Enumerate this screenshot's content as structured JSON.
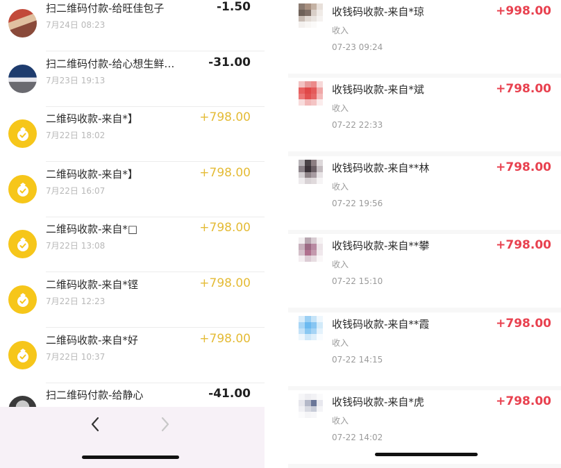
{
  "left_list": {
    "rows": [
      {
        "title": "扫二维码付款-给旺佳包子",
        "time": "7月24日 08:23",
        "amount": "-1.50",
        "kind": "payment",
        "avatar": "store-photo"
      },
      {
        "title": "扫二维码付款-给心想生鲜…",
        "time": "7月23日 19:13",
        "amount": "-31.00",
        "kind": "payment",
        "avatar": "store-photo"
      },
      {
        "title": "二维码收款-来自*】",
        "time": "7月22日 18:02",
        "amount": "+798.00",
        "kind": "receipt",
        "avatar": "money-bag"
      },
      {
        "title": "二维码收款-来自*】",
        "time": "7月22日 16:07",
        "amount": "+798.00",
        "kind": "receipt",
        "avatar": "money-bag"
      },
      {
        "title": "二维码收款-来自*□",
        "time": "7月22日 13:08",
        "amount": "+798.00",
        "kind": "receipt",
        "avatar": "money-bag"
      },
      {
        "title": "二维码收款-来自*铿",
        "time": "7月22日 12:23",
        "amount": "+798.00",
        "kind": "receipt",
        "avatar": "money-bag"
      },
      {
        "title": "二维码收款-来自*好",
        "time": "7月22日 10:37",
        "amount": "+798.00",
        "kind": "receipt",
        "avatar": "money-bag"
      },
      {
        "title": "扫二维码付款-给静心",
        "time": "",
        "amount": "-41.00",
        "kind": "payment",
        "avatar": "person-photo"
      }
    ]
  },
  "navbar": {
    "back_icon": "chevron-left-icon",
    "forward_icon": "chevron-right-icon"
  },
  "right_list": {
    "cards": [
      {
        "title": "收钱码收款-来自*琼",
        "type": "收入",
        "time": "07-23 09:24",
        "amount": "+998.00",
        "thumb": [
          "#8a7a70",
          "#a89080",
          "#c4b2a4",
          "#e8e0da",
          "#6d6058",
          "#7e6e66",
          "#d9cfc8",
          "#f0ebe7",
          "#c8bcb4",
          "#e2dad4",
          "#eae5e1",
          "#f5f2f0",
          "#f3f0ee",
          "#f8f6f4",
          "#fbfaf9",
          "#ffffff"
        ]
      },
      {
        "title": "收钱码收款-来自*斌",
        "type": "收入",
        "time": "07-22 22:33",
        "amount": "+798.00",
        "thumb": [
          "#f2c2c2",
          "#e89a9a",
          "#ec8a8a",
          "#f7d8d8",
          "#e86060",
          "#e04848",
          "#e45a5a",
          "#f0a8a8",
          "#ec7878",
          "#e25252",
          "#e66666",
          "#f3baba",
          "#f8dcdc",
          "#f2b8b8",
          "#f4c4c4",
          "#fbecec"
        ]
      },
      {
        "title": "收钱码收款-来自**林",
        "type": "收入",
        "time": "07-22 19:56",
        "amount": "+798.00",
        "thumb": [
          "#b8b4b8",
          "#4a4448",
          "#8c7e82",
          "#ddd8da",
          "#8a8288",
          "#3a3238",
          "#6a5e64",
          "#c4bcc0",
          "#d4cfd2",
          "#8e8488",
          "#a89ca2",
          "#e8e4e6",
          "#eeebed",
          "#d8d2d5",
          "#e0dadc",
          "#f6f4f5"
        ]
      },
      {
        "title": "收钱码收款-来自**攀",
        "type": "收入",
        "time": "07-22 15:10",
        "amount": "+798.00",
        "thumb": [
          "#f2eef0",
          "#b8a6b0",
          "#d8ccd2",
          "#f6f3f4",
          "#c8b0bc",
          "#9c6a84",
          "#b88aa2",
          "#ece4e8",
          "#d4c0ca",
          "#b0708e",
          "#c49aae",
          "#f0e8ec",
          "#f4eef1",
          "#dcccd4",
          "#e8dde2",
          "#faf7f8"
        ]
      },
      {
        "title": "收钱码收款-来自**霞",
        "type": "收入",
        "time": "07-22 14:15",
        "amount": "+798.00",
        "thumb": [
          "#d8ecfa",
          "#9cd0f4",
          "#c6e4f8",
          "#eef7fd",
          "#a8d6f6",
          "#6cbaf0",
          "#88c6f2",
          "#d2eaf9",
          "#c4e2f8",
          "#8ac8f2",
          "#a6d4f5",
          "#e4f2fc",
          "#eef7fd",
          "#cfe8f9",
          "#dff0fb",
          "#f8fcff"
        ]
      },
      {
        "title": "收钱码收款-来自*虎",
        "type": "收入",
        "time": "07-22 14:02",
        "amount": "+798.00",
        "thumb": [
          "#f6f6f8",
          "#eeeef2",
          "#f2f2f5",
          "#fafafb",
          "#e6e6ec",
          "#b4b8c8",
          "#6a7698",
          "#e8e8ee",
          "#f0f0f4",
          "#d8dae2",
          "#c8ccd8",
          "#f4f4f7",
          "#fbfbfc",
          "#f5f5f7",
          "#f7f7f9",
          "#ffffff"
        ]
      }
    ]
  },
  "colors": {
    "receipt_gold": "#e4bb36",
    "income_red": "#e8414f",
    "coin_yellow": "#f6c61a"
  }
}
